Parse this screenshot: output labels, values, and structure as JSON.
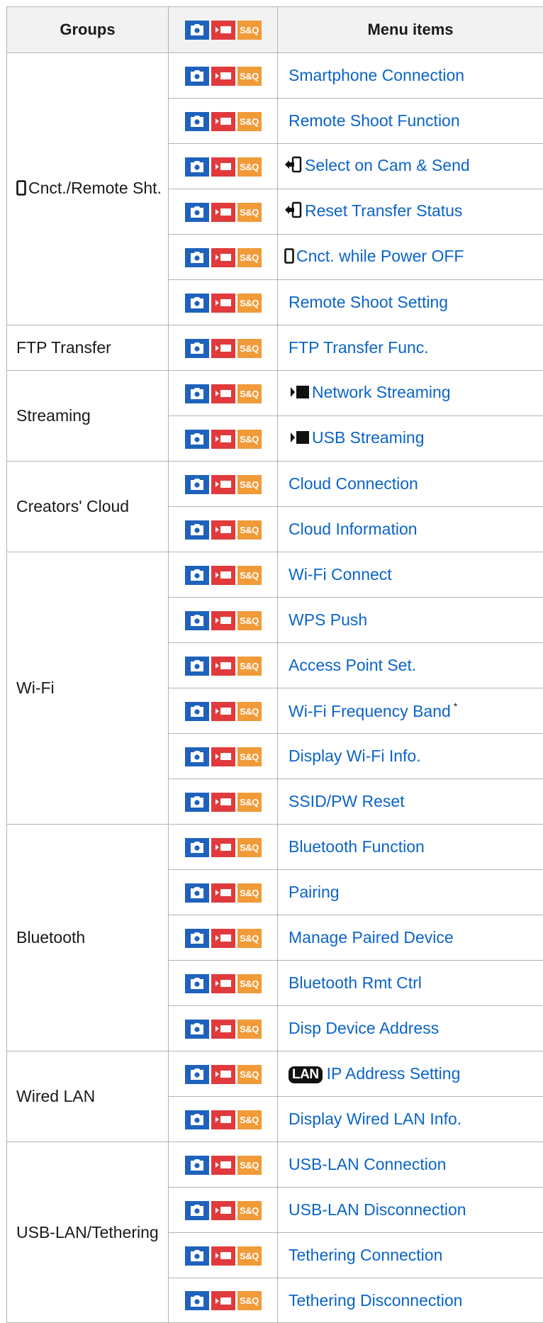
{
  "headers": {
    "groups": "Groups",
    "items": "Menu items"
  },
  "mode_icons": [
    "photo-mode-icon",
    "movie-mode-icon",
    "sq-mode-icon"
  ],
  "mode_sq_text": "S&Q",
  "colors": {
    "link": "#0b64c8",
    "photo": "#1e62bd",
    "movie": "#e03a3c",
    "sq": "#f09a38",
    "header_bg": "#f2f2f2",
    "border": "#b3b3b3"
  },
  "groups": [
    {
      "label": "Cnct./Remote Sht.",
      "icon": "smartphone-icon"
    },
    {
      "label": "FTP Transfer"
    },
    {
      "label": "Streaming"
    },
    {
      "label": "Creators' Cloud"
    },
    {
      "label": "Wi-Fi"
    },
    {
      "label": "Bluetooth"
    },
    {
      "label": "Wired LAN"
    },
    {
      "label": "USB-LAN/Tethering"
    }
  ],
  "items": [
    {
      "label": "Smartphone Connection"
    },
    {
      "label": "Remote Shoot Function"
    },
    {
      "label": "Select on Cam & Send",
      "icon": "send-to-smartphone-icon"
    },
    {
      "label": "Reset Transfer Status",
      "icon": "send-to-smartphone-icon"
    },
    {
      "label": "Cnct. while Power OFF",
      "icon": "smartphone-icon"
    },
    {
      "label": "Remote Shoot Setting"
    },
    {
      "label": "FTP Transfer Func."
    },
    {
      "label": "Network Streaming",
      "icon": "movie-icon"
    },
    {
      "label": "USB Streaming",
      "icon": "movie-icon"
    },
    {
      "label": "Cloud Connection"
    },
    {
      "label": "Cloud Information"
    },
    {
      "label": "Wi-Fi Connect"
    },
    {
      "label": "WPS Push"
    },
    {
      "label": "Access Point Set."
    },
    {
      "label": "Wi-Fi Frequency Band",
      "note": "*"
    },
    {
      "label": "Display Wi-Fi Info."
    },
    {
      "label": "SSID/PW Reset"
    },
    {
      "label": "Bluetooth Function"
    },
    {
      "label": "Pairing"
    },
    {
      "label": "Manage Paired Device"
    },
    {
      "label": "Bluetooth Rmt Ctrl"
    },
    {
      "label": "Disp Device Address"
    },
    {
      "label": "IP Address Setting",
      "badge": "LAN"
    },
    {
      "label": "Display Wired LAN Info."
    },
    {
      "label": "USB-LAN Connection"
    },
    {
      "label": "USB-LAN Disconnection"
    },
    {
      "label": "Tethering Connection"
    },
    {
      "label": "Tethering Disconnection"
    }
  ]
}
